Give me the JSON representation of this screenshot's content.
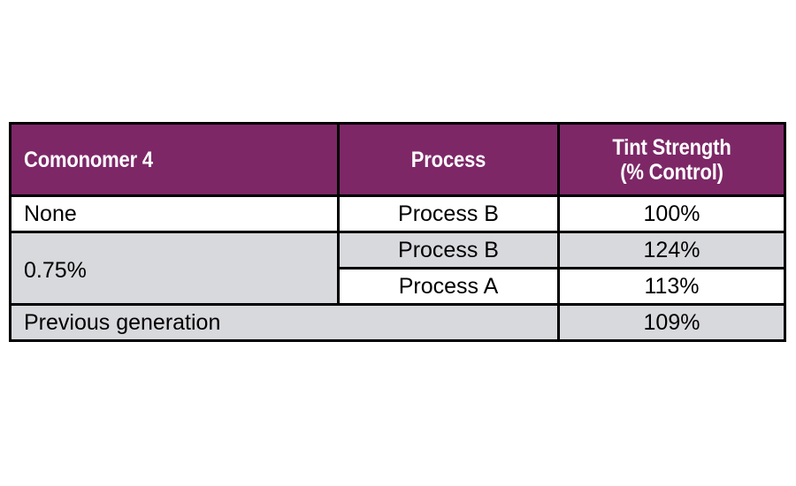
{
  "table": {
    "columns": [
      {
        "id": "comonomer",
        "label": "Comonomer 4",
        "align": "left"
      },
      {
        "id": "process",
        "label": "Process",
        "align": "center"
      },
      {
        "id": "tint",
        "label_line1": "Tint Strength",
        "label_line2": "(% Control)",
        "align": "center"
      }
    ],
    "rows": [
      {
        "comonomer": "None",
        "process": "Process B",
        "tint": "100%",
        "shaded": false
      },
      {
        "comonomer": "0.75%",
        "process": "Process B",
        "tint": "124%",
        "shaded": true
      },
      {
        "comonomer": "",
        "process": "Process A",
        "tint": "113%",
        "shaded": false
      },
      {
        "comonomer": "Previous generation",
        "process": "",
        "tint": "109%",
        "shaded": true
      }
    ],
    "colors": {
      "header_background": "#7d2767",
      "header_text": "#ffffff",
      "shade_background": "#d8d9dd",
      "border": "#000000",
      "body_text": "#000000",
      "page_background": "#ffffff"
    }
  }
}
